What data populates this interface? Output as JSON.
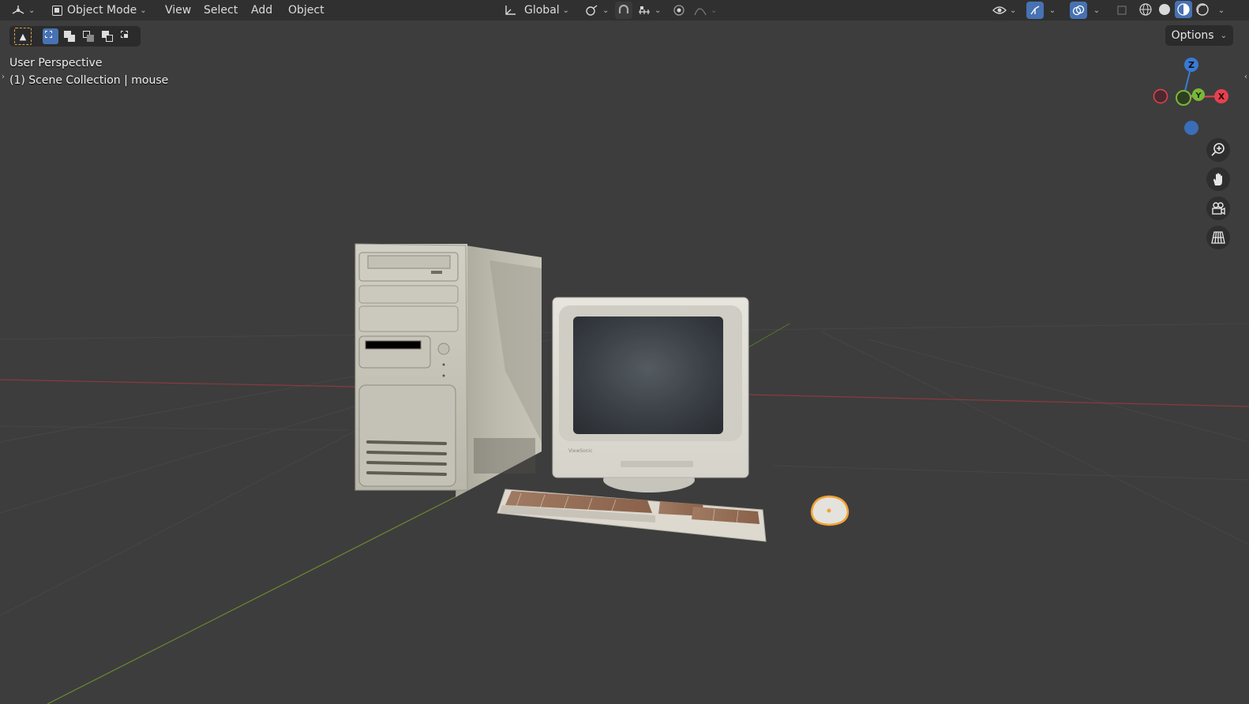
{
  "header": {
    "editor_type_icon": "3d-viewport-icon",
    "mode_label": "Object Mode",
    "menus": [
      "View",
      "Select",
      "Add",
      "Object"
    ],
    "transform_orientation": "Global",
    "icons": {
      "pivot": "pivot-point-icon",
      "snap": "snap-magnet-icon",
      "snap_target": "snap-increment-icon",
      "proportional": "proportional-editing-icon",
      "falloff": "falloff-curve-icon",
      "visibility": "eye-visibility-icon",
      "gizmos": "gizmo-toggle-icon",
      "overlays": "overlays-icon",
      "xray": "xray-toggle-icon"
    },
    "shading_modes": [
      "wireframe",
      "solid",
      "material-preview",
      "rendered"
    ],
    "active_shading": "material-preview"
  },
  "toolbar": {
    "select_tool_icon": "select-box-tool-icon",
    "selection_modes": [
      "new",
      "extend",
      "subtract",
      "invert",
      "intersect"
    ],
    "active_selection_mode": "new",
    "options_label": "Options"
  },
  "viewport": {
    "view_name": "User Perspective",
    "collection_info": "(1) Scene Collection | mouse",
    "selected_object": "mouse",
    "objects": [
      "computer-tower",
      "crt-monitor",
      "keyboard",
      "mouse"
    ]
  },
  "navigation": {
    "axes": {
      "z": "Z",
      "y": "Y",
      "x": "X"
    },
    "buttons": [
      "zoom-icon",
      "pan-hand-icon",
      "camera-view-icon",
      "perspective-grid-icon"
    ]
  },
  "colors": {
    "viewport_bg": "#3d3d3d",
    "header_bg": "#303030",
    "accent_blue": "#4772b3",
    "selection_orange": "#f2a132",
    "axis_x": "#e8404f",
    "axis_y": "#7ab838",
    "axis_z": "#3a7ad6"
  }
}
